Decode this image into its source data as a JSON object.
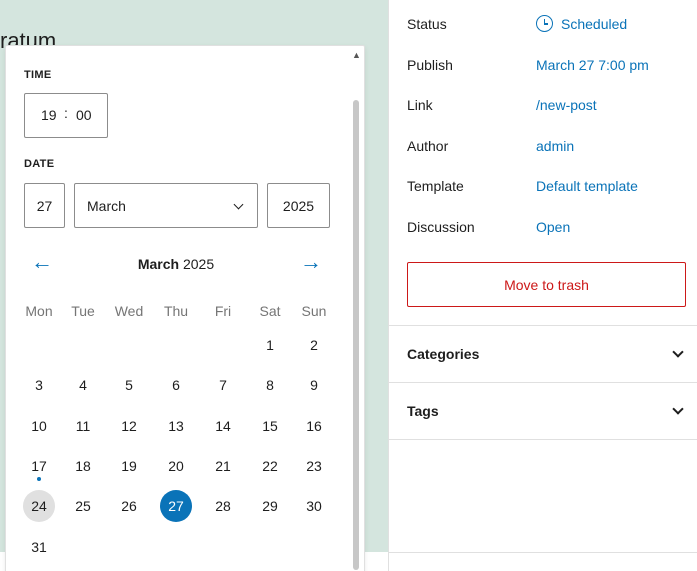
{
  "canvas": {
    "partial_title": "ratum"
  },
  "sidebar": {
    "rows": [
      {
        "label": "Status",
        "value": "Scheduled",
        "icon": "clock-icon"
      },
      {
        "label": "Publish",
        "value": "March 27 7:00 pm"
      },
      {
        "label": "Link",
        "value": "/new-post"
      },
      {
        "label": "Author",
        "value": "admin"
      },
      {
        "label": "Template",
        "value": "Default template"
      },
      {
        "label": "Discussion",
        "value": "Open"
      }
    ],
    "trash_label": "Move to trash",
    "panels": [
      {
        "title": "Categories"
      },
      {
        "title": "Tags"
      }
    ]
  },
  "picker": {
    "time_label": "TIME",
    "hour": "19",
    "time_separator": ":",
    "minute": "00",
    "date_label": "DATE",
    "day": "27",
    "month": "March",
    "year": "2025",
    "calendar": {
      "month": "March",
      "year": "2025",
      "weekdays": [
        "Mon",
        "Tue",
        "Wed",
        "Thu",
        "Fri",
        "Sat",
        "Sun"
      ],
      "weeks": [
        [
          "",
          "",
          "",
          "",
          "",
          "1",
          "2"
        ],
        [
          "3",
          "4",
          "5",
          "6",
          "7",
          "8",
          "9"
        ],
        [
          "10",
          "11",
          "12",
          "13",
          "14",
          "15",
          "16"
        ],
        [
          "17",
          "18",
          "19",
          "20",
          "21",
          "22",
          "23"
        ],
        [
          "24",
          "25",
          "26",
          "27",
          "28",
          "29",
          "30"
        ],
        [
          "31",
          "",
          "",
          "",
          "",
          "",
          ""
        ]
      ],
      "today": "24",
      "selected": "27",
      "event_day": "17"
    }
  },
  "colors": {
    "accent": "#0a73b8",
    "danger": "#cc1818",
    "canvas_bg": "#d4e5de"
  }
}
